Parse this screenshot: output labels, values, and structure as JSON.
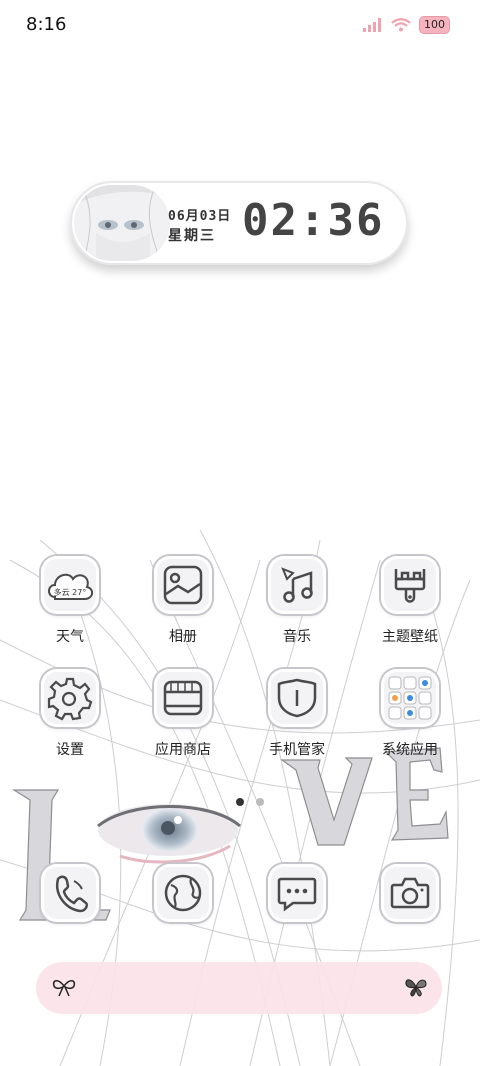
{
  "status": {
    "time": "8:16",
    "battery": "100"
  },
  "widget": {
    "date": "06月03日",
    "weekday": "星期三",
    "time": "02:36"
  },
  "apps_row1": [
    {
      "label": "天气",
      "icon": "weather-icon",
      "weather_text": "多云 27°"
    },
    {
      "label": "相册",
      "icon": "gallery-icon"
    },
    {
      "label": "音乐",
      "icon": "music-icon"
    },
    {
      "label": "主题壁纸",
      "icon": "theme-brush-icon"
    }
  ],
  "apps_row2": [
    {
      "label": "设置",
      "icon": "settings-gear-icon"
    },
    {
      "label": "应用商店",
      "icon": "store-icon"
    },
    {
      "label": "手机管家",
      "icon": "shield-icon"
    },
    {
      "label": "系统应用",
      "icon": "folder-icon"
    }
  ],
  "dock": [
    {
      "icon": "phone-icon"
    },
    {
      "icon": "browser-globe-icon"
    },
    {
      "icon": "messages-icon"
    },
    {
      "icon": "camera-icon"
    }
  ],
  "pages": {
    "count": 2,
    "active": 1
  },
  "colors": {
    "battery": "#f6b3bd",
    "search_bar": "#fce2e8",
    "icon_stroke": "#4a4a4a"
  }
}
